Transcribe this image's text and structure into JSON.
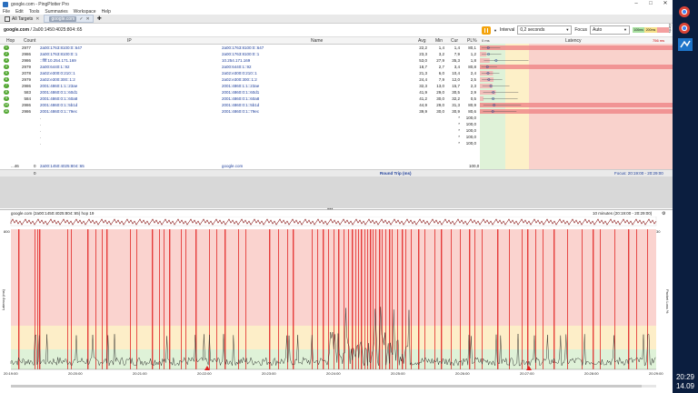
{
  "window": {
    "title": "google.com - PingPlotter Pro"
  },
  "menu": [
    "File",
    "Edit",
    "Tools",
    "Summaries",
    "Workspace",
    "Help"
  ],
  "tabs": {
    "all_targets": "All Targets",
    "current": "google.com"
  },
  "toolbar": {
    "breadcrumb_host": "google.com",
    "breadcrumb_ip": " / 2a00:1450:4025:804::65",
    "interval_label": "Interval",
    "interval_value": "0,2 seconds",
    "focus_label": "Focus",
    "focus_value": "Auto",
    "legend": [
      "100ms",
      "200ms"
    ]
  },
  "side_labels": {
    "alerts": "Alerts"
  },
  "table": {
    "headers": [
      "Hop",
      "Count",
      "IP",
      "Name",
      "Avg",
      "Min",
      "Cur",
      "PL%",
      "Latency"
    ],
    "scale_min": "0 ms",
    "scale_max": "756 ms",
    "rows": [
      {
        "hop": "1",
        "count": "2977",
        "ip": "2a00:1763:8100:0::647",
        "name": "2a00:1763:8100:0::647",
        "avg": "22,2",
        "min": "1,4",
        "cur": "1,4",
        "pl": "80,1"
      },
      {
        "hop": "2",
        "count": "2986",
        "ip": "2a00:1763:8100:0::1",
        "name": "2a00:1763:8100:0::1",
        "avg": "23,3",
        "min": "3,2",
        "cur": "7,9",
        "pl": "1,2"
      },
      {
        "hop": "3",
        "count": "2986",
        "ip": "::ffff:10.254.171.169",
        "name": "10.254.171.169",
        "avg": "53,0",
        "min": "27,9",
        "cur": "35,3",
        "pl": "1,8"
      },
      {
        "hop": "4",
        "count": "2979",
        "ip": "2a00:6440:1::92",
        "name": "2a00:6440:1::92",
        "avg": "18,7",
        "min": "2,7",
        "cur": "3,4",
        "pl": "80,8"
      },
      {
        "hop": "5",
        "count": "2078",
        "ip": "2a02:e300:0:210::1",
        "name": "2a02:e300:0:210::1",
        "avg": "21,3",
        "min": "6,0",
        "cur": "10,4",
        "pl": "2,4"
      },
      {
        "hop": "6",
        "count": "2979",
        "ip": "2a02:e300:300::1:2",
        "name": "2a02:e300:300::1:2",
        "avg": "24,4",
        "min": "7,9",
        "cur": "12,0",
        "pl": "2,5"
      },
      {
        "hop": "7",
        "count": "2986",
        "ip": "2001:4860:1:1::23ae",
        "name": "2001:4860:1:1::23ae",
        "avg": "32,3",
        "min": "13,0",
        "cur": "15,7",
        "pl": "2,3"
      },
      {
        "hop": "8",
        "count": "583",
        "ip": "2001:4860:0:1::60d1",
        "name": "2001:4860:0:1::60d1",
        "avg": "41,9",
        "min": "29,0",
        "cur": "30,5",
        "pl": "2,9"
      },
      {
        "hop": "9",
        "count": "584",
        "ip": "2001:4860:0:1::60a8",
        "name": "2001:4860:0:1::60a8",
        "avg": "41,2",
        "min": "30,0",
        "cur": "32,2",
        "pl": "0,5"
      },
      {
        "hop": "10",
        "count": "2986",
        "ip": "2001:4860:0:1::5b1d",
        "name": "2001:4860:0:1::5b1d",
        "avg": "44,9",
        "min": "29,0",
        "cur": "31,3",
        "pl": "80,9"
      },
      {
        "hop": "11",
        "count": "2986",
        "ip": "2001:4860:0:1::79ec",
        "name": "2001:4860:0:1::79ec",
        "avg": "39,9",
        "min": "30,0",
        "cur": "30,9",
        "pl": "80,6"
      },
      {
        "hop": "",
        "count": "",
        "ip": "",
        "name": "",
        "avg": "",
        "min": "",
        "cur": "*",
        "pl": "100,0"
      },
      {
        "hop": "",
        "count": "",
        "ip": "",
        "name": "",
        "avg": "",
        "min": "",
        "cur": "*",
        "pl": "100,0"
      },
      {
        "hop": "",
        "count": "",
        "ip": "",
        "name": "",
        "avg": "",
        "min": "",
        "cur": "*",
        "pl": "100,0"
      },
      {
        "hop": "",
        "count": "",
        "ip": "",
        "name": "",
        "avg": "",
        "min": "",
        "cur": "*",
        "pl": "100,0"
      },
      {
        "hop": "",
        "count": "",
        "ip": "",
        "name": "",
        "avg": "",
        "min": "",
        "cur": "*",
        "pl": "100,0"
      }
    ],
    "dest": {
      "hop": "...46",
      "count": "0",
      "ip": "2a00:1450:4025:804::65",
      "name": "google.com",
      "pl": "100,0"
    },
    "footer_count": "0",
    "round_trip_label": "Round Trip (ms)",
    "focus_range": "Focus: 20:19:00 - 20:29:00"
  },
  "chart": {
    "header_left": "google.com (2a00:1450:4025:804::65) hop 19",
    "header_right": "10 minutes (20:19:00 - 20:29:00)",
    "ylabel": "Latency (ms)",
    "ylabel_right": "Packet Loss %",
    "y_top": "800",
    "y_right_top": "30",
    "time_labels": [
      "20:19:00",
      "20:20:00",
      "20:21:00",
      "20:22:00",
      "20:23:00",
      "20:24:00",
      "20:25:00",
      "20:26:00",
      "20:27:00",
      "20:28:00",
      "20:29:00"
    ]
  },
  "clock": {
    "time": "20:29",
    "date": "14.09"
  }
}
